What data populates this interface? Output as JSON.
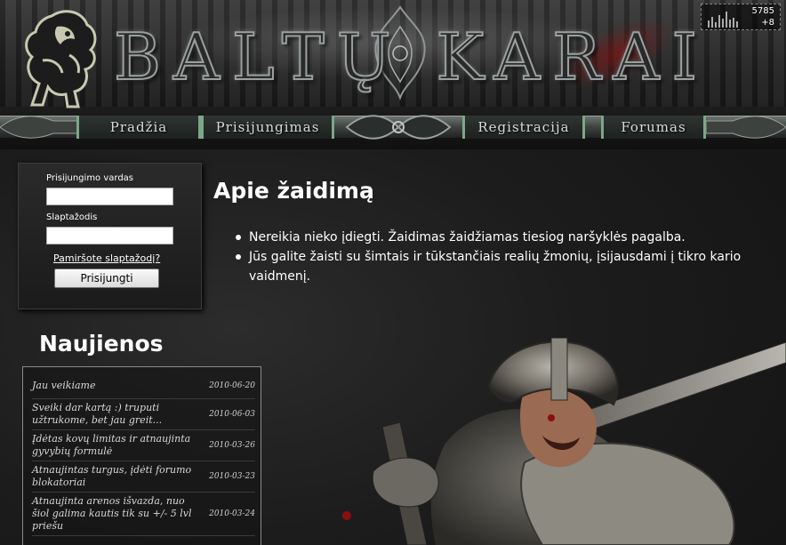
{
  "header": {
    "site_title": "BALTŲ KARAI"
  },
  "nav": {
    "home": "Pradžia",
    "login": "Prisijungimas",
    "register": "Registracija",
    "forums": "Forumas"
  },
  "counter": {
    "total": "5785",
    "today": "+8"
  },
  "login": {
    "username_label": "Prisijungimo vardas",
    "username_value": "",
    "password_label": "Slaptažodis",
    "password_value": "",
    "forgot_link": "Pamiršote slaptažodį?",
    "submit_label": "Prisijungti"
  },
  "about": {
    "title": "Apie žaidimą",
    "points": [
      "Nereikia nieko įdiegti. Žaidimas žaidžiamas tiesiog naršyklės pagalba.",
      "Jūs galite žaisti su šimtais ir tūkstančiais realių žmonių, įsijausdami į tikro kario vaidmenį."
    ]
  },
  "news": {
    "title": "Naujienos",
    "items": [
      {
        "text": "Jau veikiame",
        "date": "2010-06-20"
      },
      {
        "text": "Sveiki dar kartą :) truputi užtrukome, bet jau greit...",
        "date": "2010-06-03"
      },
      {
        "text": "Įdėtas kovų limitas ir atnaujinta gyvybių formulė",
        "date": "2010-03-26"
      },
      {
        "text": "Atnaujintas turgus, įdėti forumo blokatoriai",
        "date": "2010-03-23"
      },
      {
        "text": "Atnaujinta arenos išvazda, nuo šiol galima kautis tik su +/- 5 lvl priešu",
        "date": "2010-03-24"
      }
    ]
  },
  "colors": {
    "background": "#1a1a1a",
    "nav_accent": "#7aa888",
    "text": "#ffffff"
  },
  "icons": {
    "logo": "lion-rampant-icon",
    "ornament": "celtic-knot-ornament",
    "counter": "visitor-stats-icon"
  }
}
